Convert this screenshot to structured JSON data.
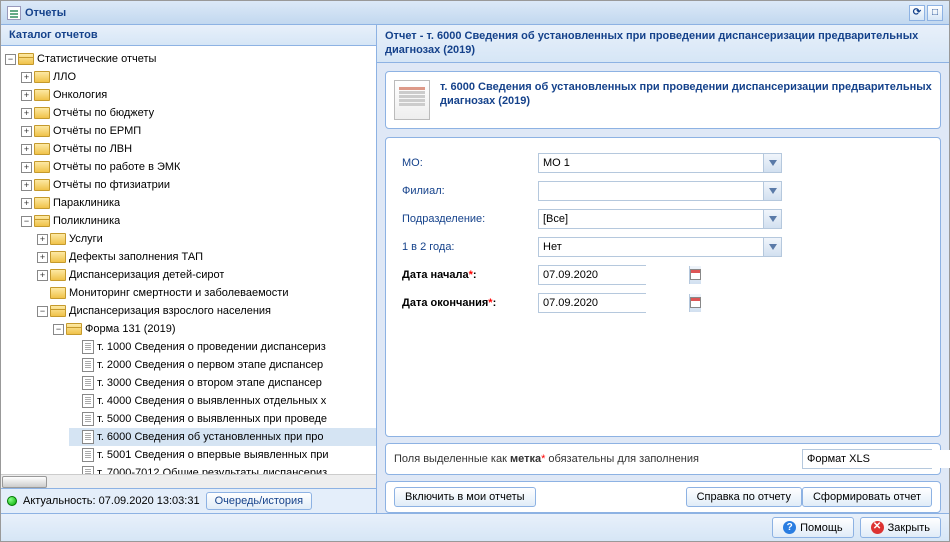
{
  "window": {
    "title": "Отчеты"
  },
  "catalog": {
    "title": "Каталог отчетов",
    "root": "Статистические отчеты",
    "items": [
      {
        "label": "ЛЛО",
        "expandable": true
      },
      {
        "label": "Онкология",
        "expandable": true
      },
      {
        "label": "Отчёты по бюджету",
        "expandable": true
      },
      {
        "label": "Отчёты по ЕРМП",
        "expandable": true
      },
      {
        "label": "Отчёты по ЛВН",
        "expandable": true
      },
      {
        "label": "Отчёты по работе в ЭМК",
        "expandable": true
      },
      {
        "label": "Отчёты по фтизиатрии",
        "expandable": true
      },
      {
        "label": "Параклиника",
        "expandable": true
      }
    ],
    "poly": {
      "label": "Поликлиника",
      "children": [
        {
          "label": "Услуги",
          "expandable": true
        },
        {
          "label": "Дефекты заполнения ТАП",
          "expandable": true
        },
        {
          "label": "Диспансеризация детей-сирот",
          "expandable": true
        },
        {
          "label": "Мониторинг смертности и заболеваемости",
          "expandable": false
        }
      ],
      "disp": {
        "label": "Диспансеризация взрослого населения",
        "form": {
          "label": "Форма 131 (2019)",
          "reports": [
            "т. 1000 Сведения о проведении диспансериз",
            "т. 2000 Сведения о первом этапе диспансер",
            "т. 3000 Сведения о втором этапе диспансер",
            "т. 4000 Сведения о выявленных отдельных х",
            "т. 5000 Сведения о выявленных при проведе",
            "т. 6000 Сведения об установленных при про",
            "т. 5001 Сведения о впервые выявленных при",
            "т. 7000-7012 Общие результаты диспансериз"
          ]
        }
      }
    },
    "status": "Актуальность: 07.09.2020 13:03:31",
    "queue_btn": "Очередь/история"
  },
  "report": {
    "header": "Отчет - т. 6000 Сведения об установленных при проведении диспансеризации предварительных диагнозах (2019)",
    "title": "т. 6000 Сведения об установленных при проведении диспансеризации предварительных диагнозах (2019)"
  },
  "form": {
    "mo": {
      "label": "МО:",
      "value": "МО 1"
    },
    "branch": {
      "label": "Филиал:",
      "value": ""
    },
    "dept": {
      "label": "Подразделение:",
      "value": "[Все]"
    },
    "freq": {
      "label": "1 в 2 года:",
      "value": "Нет"
    },
    "date_from": {
      "label": "Дата начала",
      "value": "07.09.2020"
    },
    "date_to": {
      "label": "Дата окончания",
      "value": "07.09.2020"
    },
    "note_pre": "Поля выделенные как ",
    "note_bold": "метка",
    "note_post": " обязательны для заполнения",
    "format": "Формат XLS"
  },
  "buttons": {
    "include": "Включить в мои отчеты",
    "help_report": "Справка по отчету",
    "generate": "Сформировать отчет",
    "help": "Помощь",
    "close": "Закрыть"
  }
}
